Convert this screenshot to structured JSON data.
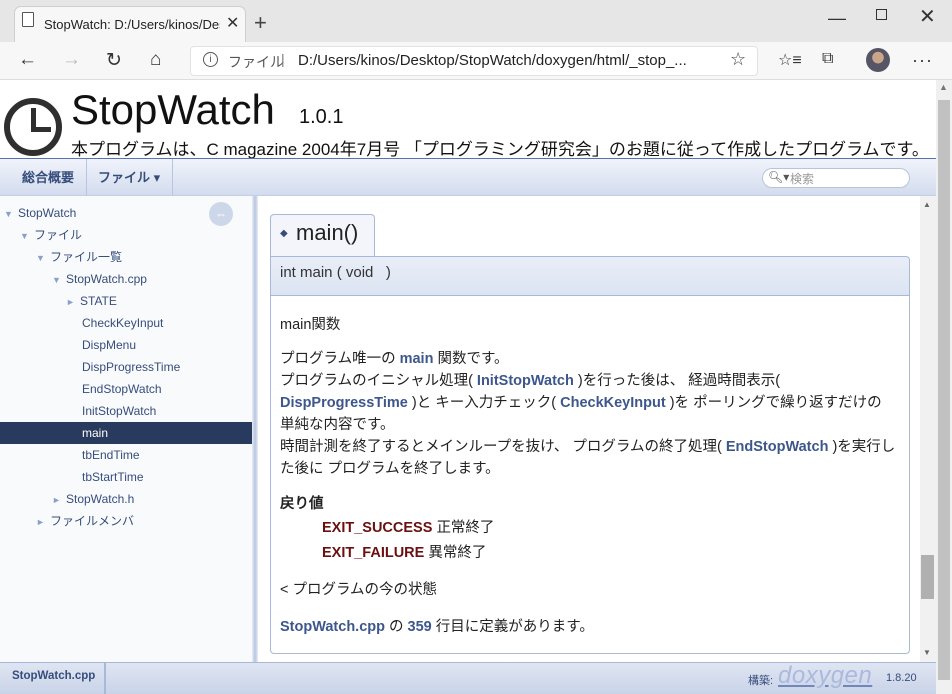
{
  "browser": {
    "tab_title": "StopWatch: D:/Users/kinos/Desk",
    "tab_close": "✕",
    "new_tab": "+",
    "scheme_label": "ファイル",
    "separator": "|",
    "url": "D:/Users/kinos/Desktop/StopWatch/doxygen/html/_stop_...",
    "icons": [
      "document-icon",
      "close-icon",
      "plus-icon",
      "back-icon",
      "forward-icon",
      "refresh-icon",
      "home-icon",
      "info-icon",
      "star-icon",
      "favorites-icon",
      "collections-icon",
      "avatar-icon",
      "more-icon"
    ]
  },
  "header": {
    "project_name": "StopWatch",
    "project_number": "1.0.1",
    "project_brief": "本プログラムは、C magazine 2004年7月号 「プログラミング研究会」のお題に従って作成したプログラムです。"
  },
  "menu": {
    "main": "総合概要",
    "files": "ファイル ▾",
    "search_placeholder": "検索"
  },
  "nav": {
    "items": [
      {
        "label": "StopWatch",
        "arrow": "▼"
      },
      {
        "label": "ファイル",
        "arrow": "▼"
      },
      {
        "label": "ファイル一覧",
        "arrow": "▼"
      },
      {
        "label": "StopWatch.cpp",
        "arrow": "▼"
      },
      {
        "label": "STATE",
        "arrow": "►"
      },
      {
        "label": "CheckKeyInput",
        "arrow": ""
      },
      {
        "label": "DispMenu",
        "arrow": ""
      },
      {
        "label": "DispProgressTime",
        "arrow": ""
      },
      {
        "label": "EndStopWatch",
        "arrow": ""
      },
      {
        "label": "InitStopWatch",
        "arrow": ""
      },
      {
        "label": "main",
        "arrow": ""
      },
      {
        "label": "tbEndTime",
        "arrow": ""
      },
      {
        "label": "tbStartTime",
        "arrow": ""
      },
      {
        "label": "StopWatch.h",
        "arrow": "►"
      },
      {
        "label": "ファイルメンバ",
        "arrow": "►"
      }
    ],
    "selected": "main"
  },
  "member": {
    "title": "main()",
    "prototype": "int main ( void   )",
    "brief": "main関数",
    "p1_a": "プログラム唯一の ",
    "p1_link": "main",
    "p1_b": " 関数です。",
    "p2_a": "プログラムのイニシャル処理( ",
    "p2_link1": "InitStopWatch",
    "p2_b": " )を行った後は、 経過時間表示(",
    "p3_link": "DispProgressTime",
    "p3_a": " )と キー入力チェック( ",
    "p3_link2": "CheckKeyInput",
    "p3_b": " )を ポーリングで繰り返すだけの",
    "p4": "単純な内容です。",
    "p5_a": "時間計測を終了するとメインループを抜け、 プログラムの終了処理( ",
    "p5_link": "EndStopWatch",
    "p5_b": " )を実行し",
    "p6": "た後に プログラムを終了します。",
    "retval_title": "戻り値",
    "retvals": [
      {
        "name": "EXIT_SUCCESS",
        "desc": "正常終了"
      },
      {
        "name": "EXIT_FAILURE",
        "desc": "異常終了"
      }
    ],
    "state_note": "< プログラムの今の状態",
    "def_file": "StopWatch.cpp",
    "def_a": " の ",
    "def_line": "359",
    "def_b": " 行目に定義があります。"
  },
  "footer": {
    "path": "StopWatch.cpp",
    "generated_by": "構築:",
    "logo": "doxygen",
    "version": "1.8.20"
  }
}
